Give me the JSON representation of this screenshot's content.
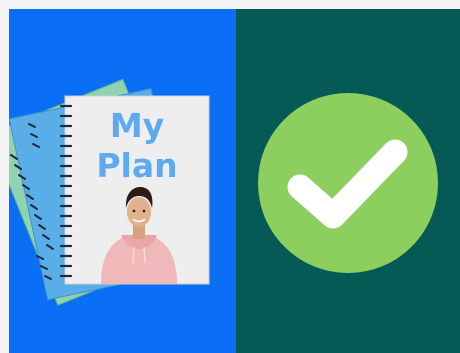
{
  "left_panel": {
    "color": "#0a6ff5",
    "notebook": {
      "title_line1": "My",
      "title_line2": "Plan",
      "page_color": "#eeeeee",
      "title_color": "#5fa8f2",
      "back_notebook_colors": [
        "#8fd3b0",
        "#5aaee8",
        "#3f8fe0"
      ],
      "photo_subject": "boy-in-pink-hoodie"
    }
  },
  "right_panel": {
    "color": "#065a55",
    "check_circle_color": "#8ccf5e",
    "check_color": "#ffffff",
    "icon": "checkmark-icon"
  }
}
